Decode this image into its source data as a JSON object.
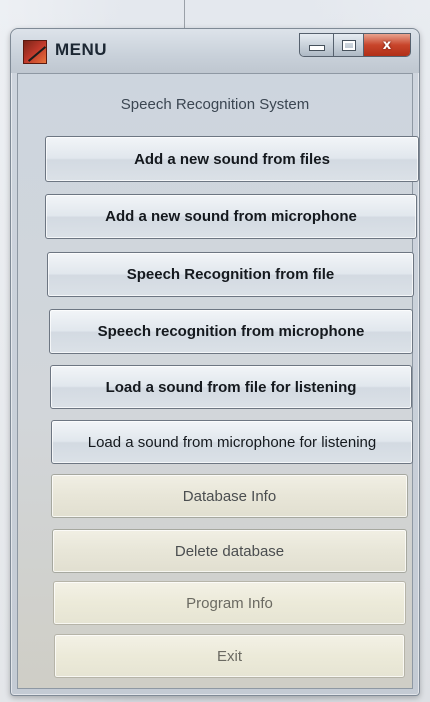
{
  "window": {
    "title": "MENU",
    "controls": {
      "minimize": "minimize",
      "maximize": "maximize",
      "close": "x"
    }
  },
  "heading": "Speech Recognition System",
  "buttons": [
    {
      "label": "Add a new sound from files"
    },
    {
      "label": "Add a new sound from microphone"
    },
    {
      "label": "Speech Recognition from file"
    },
    {
      "label": "Speech recognition from microphone"
    },
    {
      "label": "Load a sound from file for listening"
    },
    {
      "label": "Load a sound from microphone for listening"
    },
    {
      "label": "Database Info"
    },
    {
      "label": "Delete database"
    },
    {
      "label": "Program Info"
    },
    {
      "label": "Exit"
    }
  ],
  "colors": {
    "close_button": "#c8452b",
    "app_icon": "#c0392b"
  }
}
